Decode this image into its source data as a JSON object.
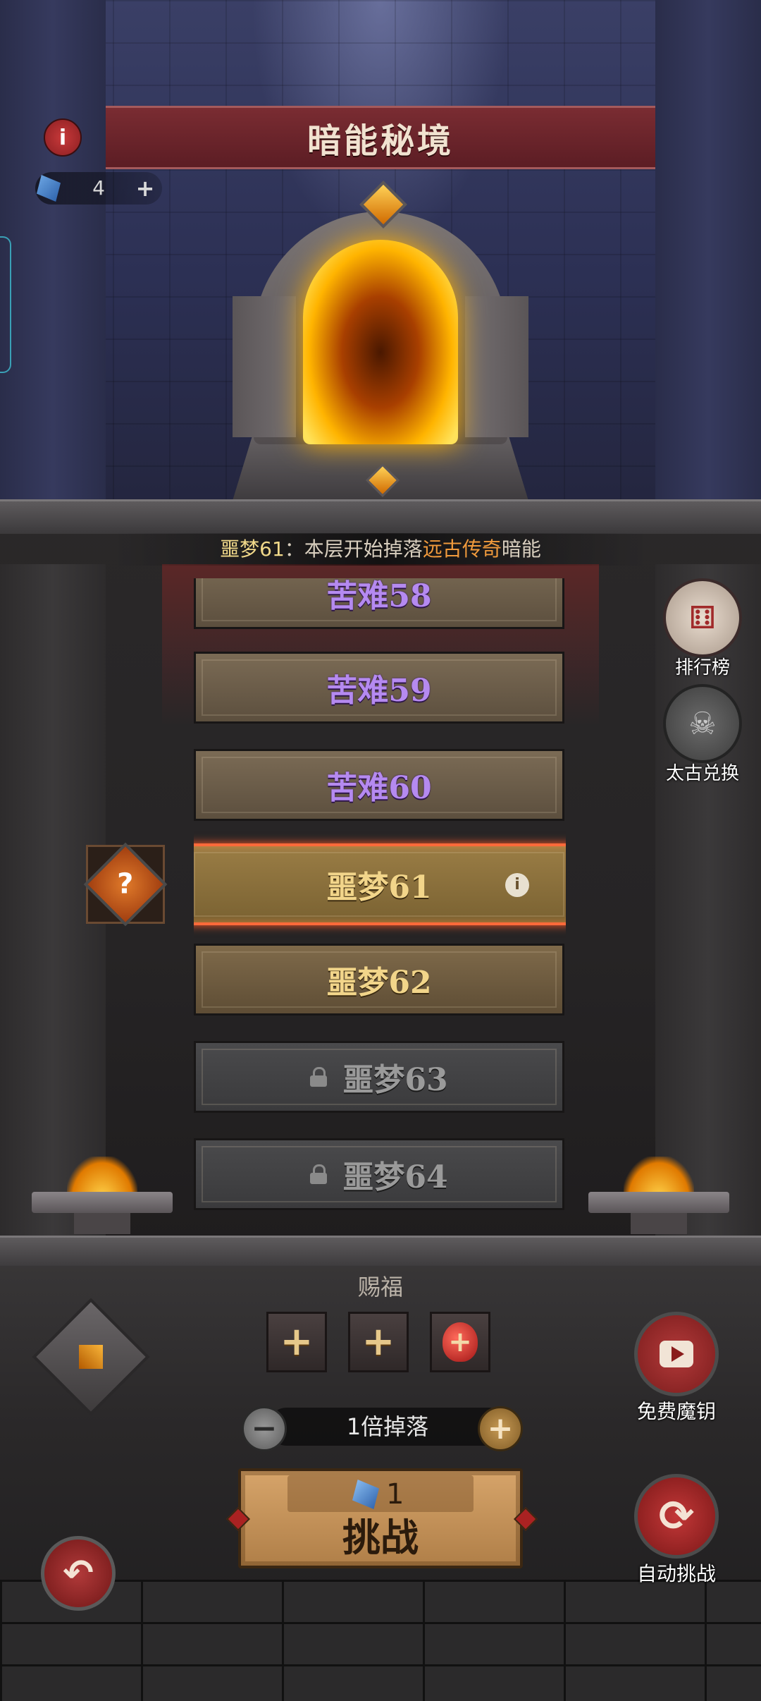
{
  "header": {
    "title": "暗能秘境",
    "info_icon": "info-icon",
    "key_count": "4",
    "key_plus": "+"
  },
  "drop_notice": {
    "level": "噩梦61",
    "sep": "：",
    "prefix": "本层开始掉落",
    "highlight": "远古传奇",
    "suffix": "暗能"
  },
  "levels": [
    {
      "label": "苦难58",
      "state": "completed"
    },
    {
      "label": "苦难59",
      "state": "completed"
    },
    {
      "label": "苦难60",
      "state": "completed"
    },
    {
      "label": "噩梦61",
      "state": "selected"
    },
    {
      "label": "噩梦62",
      "state": "available"
    },
    {
      "label": "噩梦63",
      "state": "locked"
    },
    {
      "label": "噩梦64",
      "state": "locked"
    }
  ],
  "mystery_box": {
    "glyph": "?"
  },
  "side_buttons": {
    "ranking_label": "排行榜",
    "exchange_label": "太古兑换"
  },
  "blessing": {
    "title": "赐福",
    "slots": [
      "+",
      "+",
      "+"
    ]
  },
  "multiplier": {
    "text": "1倍掉落",
    "minus": "−",
    "plus": "+"
  },
  "challenge": {
    "cost": "1",
    "label": "挑战"
  },
  "free_key": {
    "label": "免费魔钥"
  },
  "auto_challenge": {
    "label": "自动挑战"
  },
  "colors": {
    "title_banner": "#7a2c32",
    "selected_border": "#ff6a3a",
    "highlight_text": "#f09a3c",
    "purple_label": "#b58af0",
    "gold_label": "#f2d58a"
  }
}
